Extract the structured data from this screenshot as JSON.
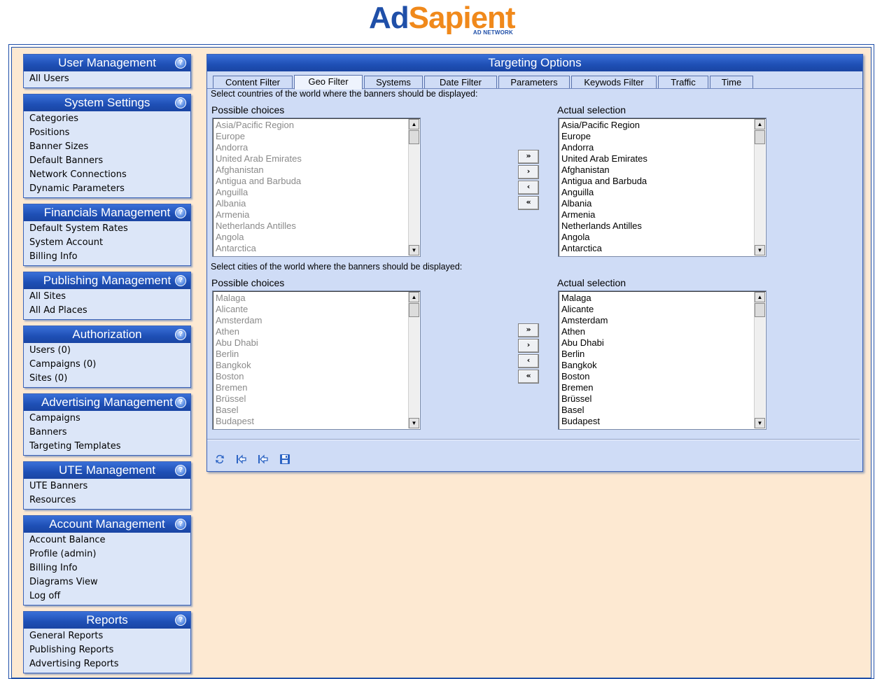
{
  "logo": {
    "part1": "Ad",
    "part2": "S",
    "part3": "apient",
    "tagline": "AD NETWORK"
  },
  "help_glyph": "?",
  "sidebar": [
    {
      "title": "User Management",
      "items": [
        "All Users"
      ]
    },
    {
      "title": "System Settings",
      "items": [
        "Categories",
        "Positions",
        "Banner Sizes",
        "Default Banners",
        "Network Connections",
        "Dynamic Parameters"
      ]
    },
    {
      "title": "Financials Management",
      "items": [
        "Default System Rates",
        "System Account",
        "Billing Info"
      ]
    },
    {
      "title": "Publishing Management",
      "items": [
        "All Sites",
        "All Ad Places"
      ]
    },
    {
      "title": "Authorization",
      "items": [
        "Users (0)",
        "Campaigns (0)",
        "Sites (0)"
      ]
    },
    {
      "title": "Advertising Management",
      "items": [
        "Campaigns",
        "Banners",
        "Targeting Templates"
      ]
    },
    {
      "title": "UTE Management",
      "items": [
        "UTE Banners",
        "Resources"
      ]
    },
    {
      "title": "Account Management",
      "items": [
        "Account Balance",
        "Profile (admin)",
        "Billing Info",
        "Diagrams View",
        "Log off"
      ]
    },
    {
      "title": "Reports",
      "items": [
        "General Reports",
        "Publishing Reports",
        "Advertising Reports"
      ]
    }
  ],
  "panel": {
    "title": "Targeting Options",
    "tabs": [
      "Content Filter",
      "Geo Filter",
      "Systems",
      "Date Filter",
      "Parameters",
      "Keywods Filter",
      "Traffic",
      "Time"
    ],
    "active_tab": "Geo Filter",
    "countries": {
      "description": "Select countries of the world where the banners should be displayed:",
      "possible_label": "Possible choices",
      "actual_label": "Actual selection",
      "possible": [
        "Asia/Pacific Region",
        "Europe",
        "Andorra",
        "United Arab Emirates",
        "Afghanistan",
        "Antigua and Barbuda",
        "Anguilla",
        "Albania",
        "Armenia",
        "Netherlands Antilles",
        "Angola",
        "Antarctica"
      ],
      "actual": [
        "Asia/Pacific Region",
        "Europe",
        "Andorra",
        "United Arab Emirates",
        "Afghanistan",
        "Antigua and Barbuda",
        "Anguilla",
        "Albania",
        "Armenia",
        "Netherlands Antilles",
        "Angola",
        "Antarctica"
      ]
    },
    "cities": {
      "description": "Select cities of the world where the banners should be displayed:",
      "possible_label": "Possible choices",
      "actual_label": "Actual selection",
      "possible": [
        "Malaga",
        "Alicante",
        "Amsterdam",
        "Athen",
        "Abu Dhabi",
        "Berlin",
        "Bangkok",
        "Boston",
        "Bremen",
        "Brüssel",
        "Basel",
        "Budapest"
      ],
      "actual": [
        "Malaga",
        "Alicante",
        "Amsterdam",
        "Athen",
        "Abu Dhabi",
        "Berlin",
        "Bangkok",
        "Boston",
        "Bremen",
        "Brüssel",
        "Basel",
        "Budapest"
      ]
    },
    "move_buttons": [
      "»",
      "›",
      "‹",
      "«"
    ],
    "toolbar": [
      "refresh-icon",
      "back-icon",
      "back-alt-icon",
      "save-icon"
    ]
  },
  "colors": {
    "header_blue": "#1e4fb5",
    "accent_orange": "#f0891b",
    "page_bg": "#fde9d2",
    "panel_bg": "#cfdcf6"
  }
}
